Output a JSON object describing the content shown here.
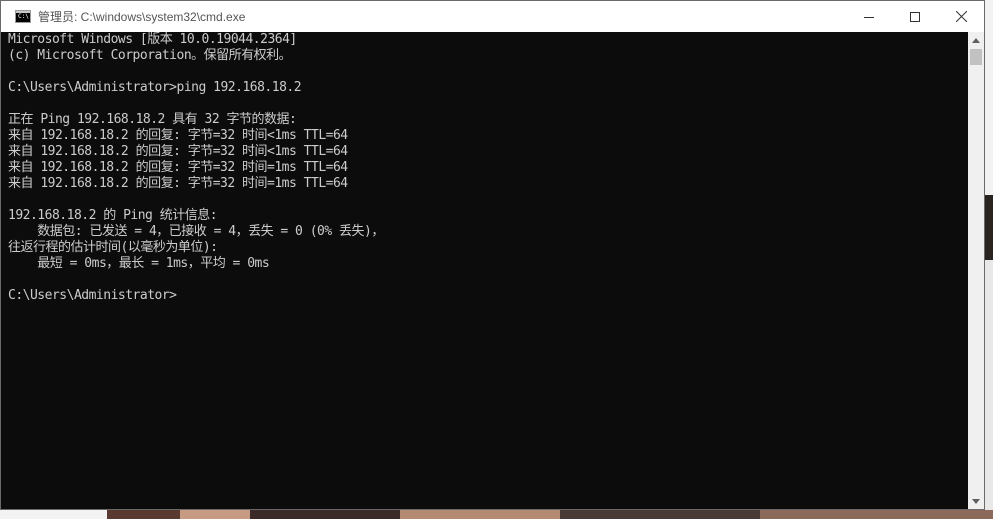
{
  "window": {
    "title": "管理员: C:\\windows\\system32\\cmd.exe",
    "app_icon_text": "C:\\"
  },
  "caption_buttons": {
    "minimize_icon": "minimize-icon",
    "maximize_icon": "maximize-icon",
    "close_icon": "close-icon"
  },
  "console": {
    "lines": [
      "Microsoft Windows [版本 10.0.19044.2364]",
      "(c) Microsoft Corporation。保留所有权利。",
      "",
      "C:\\Users\\Administrator>ping 192.168.18.2",
      "",
      "正在 Ping 192.168.18.2 具有 32 字节的数据:",
      "来自 192.168.18.2 的回复: 字节=32 时间<1ms TTL=64",
      "来自 192.168.18.2 的回复: 字节=32 时间<1ms TTL=64",
      "来自 192.168.18.2 的回复: 字节=32 时间=1ms TTL=64",
      "来自 192.168.18.2 的回复: 字节=32 时间=1ms TTL=64",
      "",
      "192.168.18.2 的 Ping 统计信息:",
      "    数据包: 已发送 = 4，已接收 = 4，丢失 = 0 (0% 丢失)，",
      "往返行程的估计时间(以毫秒为单位):",
      "    最短 = 0ms，最长 = 1ms，平均 = 0ms",
      "",
      "C:\\Users\\Administrator>"
    ]
  },
  "colors": {
    "console_bg": "#0c0c0c",
    "console_fg": "#cccccc",
    "titlebar_bg": "#ffffff"
  }
}
